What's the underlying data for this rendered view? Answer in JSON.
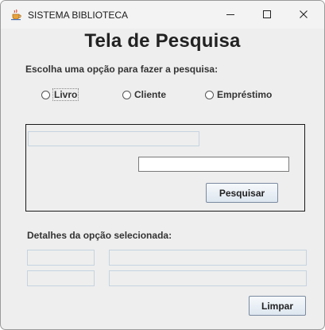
{
  "window": {
    "title": "SISTEMA BIBLIOTECA",
    "icon": "java-cup-icon",
    "controls": [
      "minimize-icon",
      "maximize-icon",
      "close-icon"
    ]
  },
  "main": {
    "heading": "Tela de Pesquisa",
    "prompt": "Escolha uma opção para fazer a pesquisa:",
    "options": [
      {
        "label": "Livro",
        "selected": false,
        "focused": true
      },
      {
        "label": "Cliente",
        "selected": false,
        "focused": false
      },
      {
        "label": "Empréstimo",
        "selected": false,
        "focused": false
      }
    ]
  },
  "search": {
    "label_field_value": "",
    "input_value": "",
    "button_label": "Pesquisar"
  },
  "details": {
    "label": "Detalhes da opção selecionada:",
    "fields": [
      "",
      "",
      "",
      ""
    ]
  },
  "footer": {
    "clear_button_label": "Limpar"
  },
  "colors": {
    "window_bg": "#eeeeee",
    "titlebar_bg": "#f3f3f3",
    "field_border": "#c5d3e0",
    "panel_border": "#1a1a1a"
  }
}
